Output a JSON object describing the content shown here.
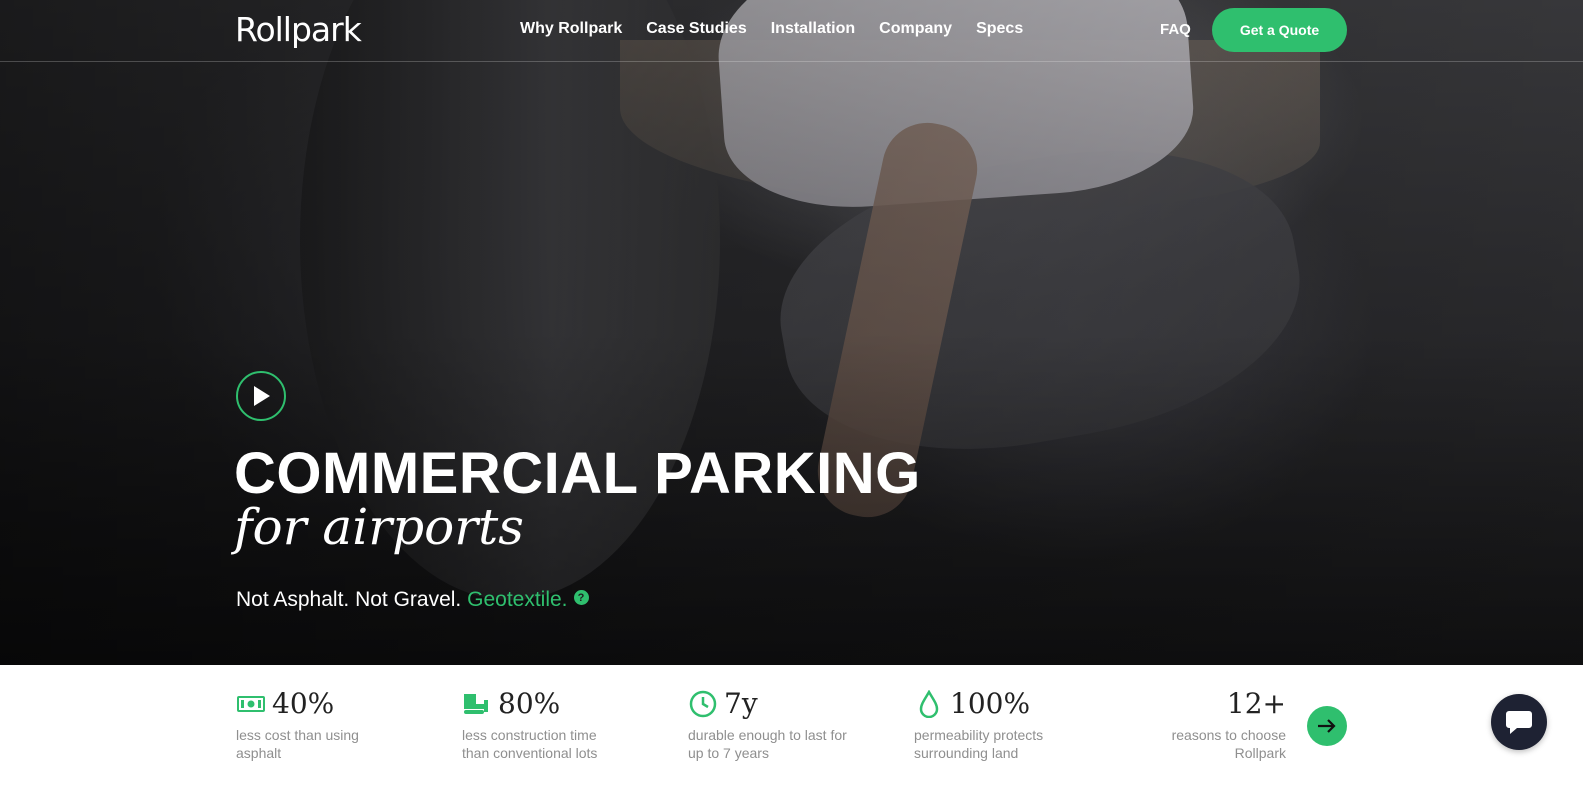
{
  "brand": {
    "logo_text": "Rollpark",
    "accent": "#2fbf6e"
  },
  "nav": {
    "links": [
      "Why Rollpark",
      "Case Studies",
      "Installation",
      "Company",
      "Specs"
    ],
    "faq": "FAQ",
    "cta": "Get a Quote"
  },
  "hero": {
    "title": "COMMERCIAL PARKING",
    "subtitle": "for airports",
    "tagline_plain": "Not Asphalt. Not Gravel.",
    "tagline_accent": "Geotextile.",
    "help_icon": "?",
    "play_icon": "play-icon"
  },
  "stats": [
    {
      "icon": "money-icon",
      "value": "40%",
      "desc": "less cost than using asphalt"
    },
    {
      "icon": "bulldozer-icon",
      "value": "80%",
      "desc": "less construction time than conventional lots"
    },
    {
      "icon": "clock-icon",
      "value": "7y",
      "desc": "durable enough to last for up to 7 years"
    },
    {
      "icon": "water-drop-icon",
      "value": "100%",
      "desc": "permeability protects surrounding land"
    }
  ],
  "reasons": {
    "value": "12+",
    "desc": "reasons to choose Rollpark"
  },
  "chat": {
    "icon": "chat-icon"
  }
}
